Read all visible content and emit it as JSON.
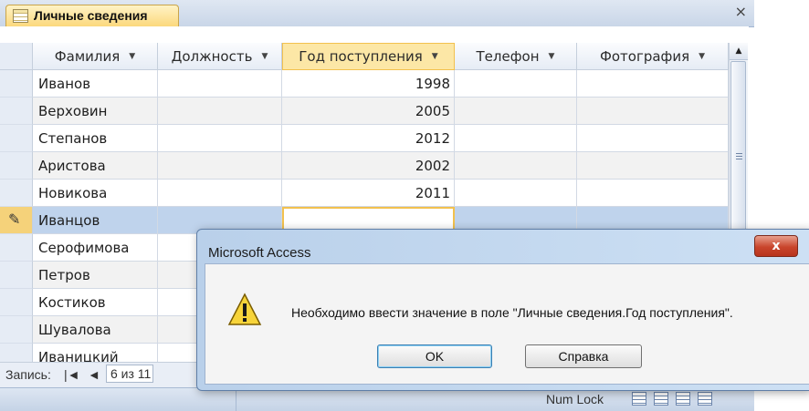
{
  "tab": {
    "label": "Личные сведения",
    "close": "×"
  },
  "columns": [
    {
      "label": "Фамилия",
      "arrow": "▼"
    },
    {
      "label": "Должность",
      "arrow": "▼"
    },
    {
      "label": "Год поступления",
      "arrow": "▼"
    },
    {
      "label": "Телефон",
      "arrow": "▼"
    },
    {
      "label": "Фотография",
      "arrow": "▼"
    }
  ],
  "rows": [
    {
      "surname": "Иванов",
      "year": "1998"
    },
    {
      "surname": "Верховин",
      "year": "2005"
    },
    {
      "surname": "Степанов",
      "year": "2012"
    },
    {
      "surname": "Аристова",
      "year": "2002"
    },
    {
      "surname": "Новикова",
      "year": "2011"
    },
    {
      "surname": "Иванцов",
      "year": ""
    },
    {
      "surname": "Серофимова",
      "year": ""
    },
    {
      "surname": "Петров",
      "year": ""
    },
    {
      "surname": "Костиков",
      "year": ""
    },
    {
      "surname": "Шувалова",
      "year": ""
    },
    {
      "surname": "Иваницкий",
      "year": ""
    }
  ],
  "current_row_index": 5,
  "record_nav": {
    "label": "Запись:",
    "first": "|◄",
    "prev": "◄",
    "current": "6 из 11"
  },
  "status": {
    "numlock": "Num Lock"
  },
  "dialog": {
    "title": "Microsoft Access",
    "close": "x",
    "message": "Необходимо ввести значение в поле \"Личные сведения.Год поступления\".",
    "ok": "OK",
    "help": "Справка"
  },
  "colors": {
    "accent": "#f2c14e",
    "selected_row": "#bfd3ec",
    "dialog_close": "#c9452c"
  }
}
